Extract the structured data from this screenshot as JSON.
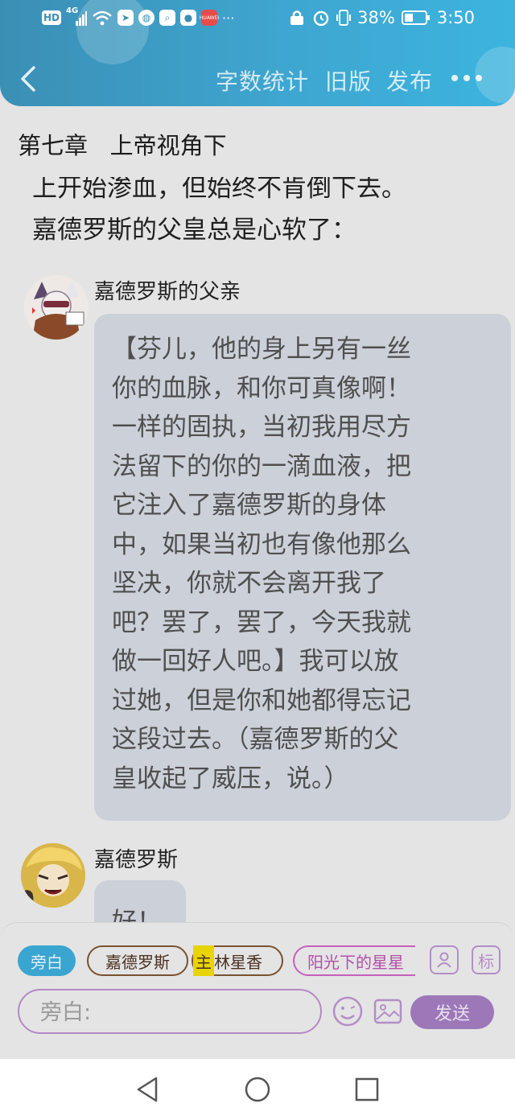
{
  "status_bar": {
    "left_icons": [
      "HD",
      "4G",
      "wifi-icon",
      "direction-app-icon",
      "browser-app-icon",
      "search-app-icon",
      "bulb-app-icon",
      "store-app-icon",
      "more-dots"
    ],
    "hd_label": "HD",
    "signal_label": "4G",
    "store_label": "HUAWEI",
    "more": "···",
    "battery_percent": "38%",
    "time": "3:50"
  },
  "header": {
    "word_count": "字数统计",
    "old_version": "旧版",
    "publish": "发布"
  },
  "chapter": {
    "title": "第七章   上帝视角下"
  },
  "story": {
    "narration_lines": [
      "上开始渗血，但始终不肯倒下去。",
      "嘉德罗斯的父皇总是心软了："
    ],
    "messages": [
      {
        "speaker": "嘉德罗斯的父亲",
        "lines": [
          "【芬儿，他的身上另有一丝",
          "你的血脉，和你可真像啊！",
          "一样的固执，当初我用尽方",
          "法留下的你的一滴血液，把",
          "它注入了嘉德罗斯的身体",
          "中，如果当初也有像他那么",
          "坚决，你就不会离开我了",
          "吧？罢了，罢了，今天我就",
          "做一回好人吧。】我可以放",
          "过她，但是你和她都得忘记",
          "这段过去。（嘉德罗斯的父",
          "皇收起了威压，说。）"
        ]
      },
      {
        "speaker": "嘉德罗斯",
        "lines": [
          "好！"
        ]
      }
    ]
  },
  "composer": {
    "roles": {
      "narrator": "旁白",
      "role1": "嘉德罗斯",
      "role2_tag": "主",
      "role2": "林星香",
      "role3": "阳光下的星星"
    },
    "tag_button": "标",
    "input_placeholder": "旁白:",
    "send": "发送"
  },
  "colors": {
    "header": "#3ea6d0",
    "accent_purple": "#9c78b8",
    "bubble": "#ccd0d9",
    "narrator_pill": "#3aa5d1",
    "role_border": "#7a5230",
    "tag_highlight": "#e7d400"
  }
}
